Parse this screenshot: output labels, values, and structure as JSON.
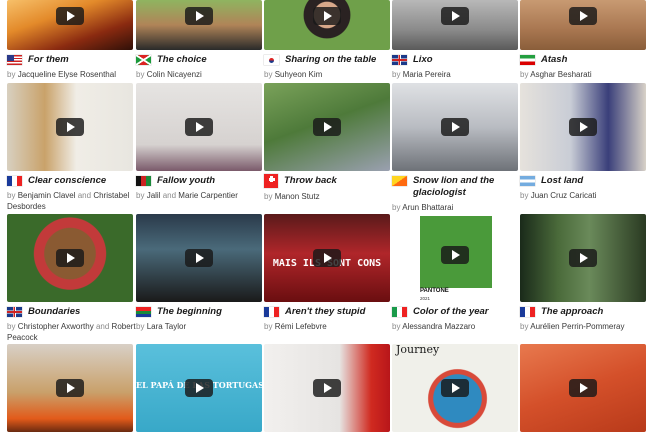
{
  "cards": [
    {
      "title": "For them",
      "by": "by",
      "author1": "Jacqueline Elyse Rosenthal",
      "and": "",
      "author2": "",
      "flag": "flag-usa",
      "thumb_overlay": ""
    },
    {
      "title": "The choice",
      "by": "by",
      "author1": "Colin Nicayenzi",
      "and": "",
      "author2": "",
      "flag": "flag-burundi",
      "thumb_overlay": ""
    },
    {
      "title": "Sharing on the table",
      "by": "by",
      "author1": "Suhyeon Kim",
      "and": "",
      "author2": "",
      "flag": "flag-south-korea",
      "thumb_overlay": ""
    },
    {
      "title": "Lixo",
      "by": "by",
      "author1": "Maria Pereira",
      "and": "",
      "author2": "",
      "flag": "flag-united-kingdom",
      "thumb_overlay": ""
    },
    {
      "title": "Atash",
      "by": "by",
      "author1": "Asghar Besharati",
      "and": "",
      "author2": "",
      "flag": "flag-iran",
      "thumb_overlay": ""
    },
    {
      "title": "Clear conscience",
      "by": "by",
      "author1": "Benjamin Clavel",
      "and": "and",
      "author2": "Christabel Desbordes",
      "flag": "flag-france",
      "thumb_overlay": ""
    },
    {
      "title": "Fallow youth",
      "by": "by",
      "author1": "Jalil",
      "and": "and",
      "author2": "Marie Carpentier",
      "flag": "flag-afghanistan",
      "thumb_overlay": ""
    },
    {
      "title": "Throw back",
      "by": "by",
      "author1": "Manon Stutz",
      "and": "",
      "author2": "",
      "flag": "flag-switzerland",
      "thumb_overlay": ""
    },
    {
      "title": "Snow lion and the glaciologist",
      "by": "by",
      "author1": "Arun Bhattarai",
      "and": "",
      "author2": "",
      "flag": "flag-bhutan",
      "thumb_overlay": ""
    },
    {
      "title": "Lost land",
      "by": "by",
      "author1": "Juan Cruz Caricati",
      "and": "",
      "author2": "",
      "flag": "flag-argentina",
      "thumb_overlay": ""
    },
    {
      "title": "Boundaries",
      "by": "by",
      "author1": "Christopher Axworthy",
      "and": "and",
      "author2": "Robert Peacock",
      "flag": "flag-united-kingdom",
      "thumb_overlay": ""
    },
    {
      "title": "The beginning",
      "by": "by",
      "author1": "Lara Taylor",
      "and": "",
      "author2": "",
      "flag": "flag-south-africa",
      "thumb_overlay": ""
    },
    {
      "title": "Aren't they stupid",
      "by": "by",
      "author1": "Rémi Lefebvre",
      "and": "",
      "author2": "",
      "flag": "flag-france",
      "thumb_overlay": "MAIS ILS SONT CONS"
    },
    {
      "title": "Color of the year",
      "by": "by",
      "author1": "Alessandra Mazzaro",
      "and": "",
      "author2": "",
      "flag": "flag-italy",
      "thumb_overlay": "PANTONE"
    },
    {
      "title": "The approach",
      "by": "by",
      "author1": "Aurélien Perrin-Pommeray",
      "and": "",
      "author2": "",
      "flag": "flag-france",
      "thumb_overlay": ""
    },
    {
      "title": "",
      "by": "",
      "author1": "",
      "and": "",
      "author2": "",
      "flag": "",
      "thumb_overlay": ""
    },
    {
      "title": "",
      "by": "",
      "author1": "",
      "and": "",
      "author2": "",
      "flag": "",
      "thumb_overlay": "EL PAPÁ DE LAS TORTUGAS"
    },
    {
      "title": "",
      "by": "",
      "author1": "",
      "and": "",
      "author2": "",
      "flag": "",
      "thumb_overlay": ""
    },
    {
      "title": "",
      "by": "",
      "author1": "",
      "and": "",
      "author2": "",
      "flag": "",
      "thumb_overlay": "Journey"
    },
    {
      "title": "",
      "by": "",
      "author1": "",
      "and": "",
      "author2": "",
      "flag": "",
      "thumb_overlay": ""
    }
  ],
  "pantone": {
    "sub": "2021"
  }
}
